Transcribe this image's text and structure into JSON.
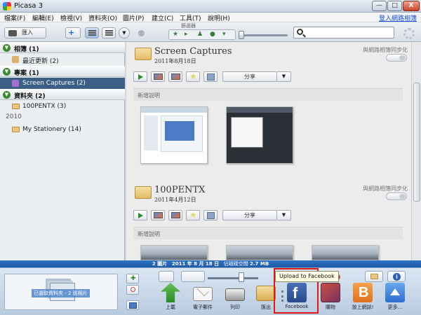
{
  "window": {
    "title": "Picasa 3",
    "min": "—",
    "max": "□",
    "close": "X"
  },
  "menu": {
    "items": [
      "檔案(F)",
      "編輯(E)",
      "檢視(V)",
      "資料夾(O)",
      "圖片(P)",
      "建立(C)",
      "工具(T)",
      "說明(H)"
    ],
    "sign_in": "登入網路相簿"
  },
  "toolbar": {
    "import_label": "匯入",
    "filter_label": "篩選器",
    "search_placeholder": ""
  },
  "sidebar": {
    "sections": [
      {
        "label": "相簿 (1)"
      },
      {
        "label": "專案 (1)"
      },
      {
        "label": "資料夾 (2)"
      }
    ],
    "items": [
      {
        "label": "最近更新 (2)"
      },
      {
        "label": "Screen Captures (2)"
      },
      {
        "label": "100PENTX (3)"
      },
      {
        "label": "My Stationery (14)"
      }
    ],
    "year": "2010"
  },
  "groups": [
    {
      "title": "Screen Captures",
      "date": "2011年8月18日",
      "sync_label": "與網路相簿同步化",
      "share": "分享",
      "desc": "新增說明"
    },
    {
      "title": "100PENTX",
      "date": "2011年4月12日",
      "sync_label": "與網路相簿同步化",
      "share": "分享",
      "desc": "新增說明"
    }
  ],
  "status": {
    "count": "2 圖片",
    "date": "2011 年 8 月 18 日",
    "disk_label": "佔磁碟空間",
    "size": "2.7 MB"
  },
  "tray": {
    "selection_caption": "已選取資料夾 - 2 張相片",
    "tooltip": "Upload to Facebook",
    "actions": [
      {
        "label": "上載"
      },
      {
        "label": "電子郵件"
      },
      {
        "label": "列印"
      },
      {
        "label": "匯出"
      },
      {
        "label": "Facebook"
      },
      {
        "label": "購物"
      },
      {
        "label": "放上網誌!"
      },
      {
        "label": "更多..."
      }
    ]
  },
  "colors": {
    "selected_row": "#3c5f86",
    "status_bar": "#1e5aa8",
    "highlight": "#e01818",
    "facebook": "#3b5998"
  }
}
